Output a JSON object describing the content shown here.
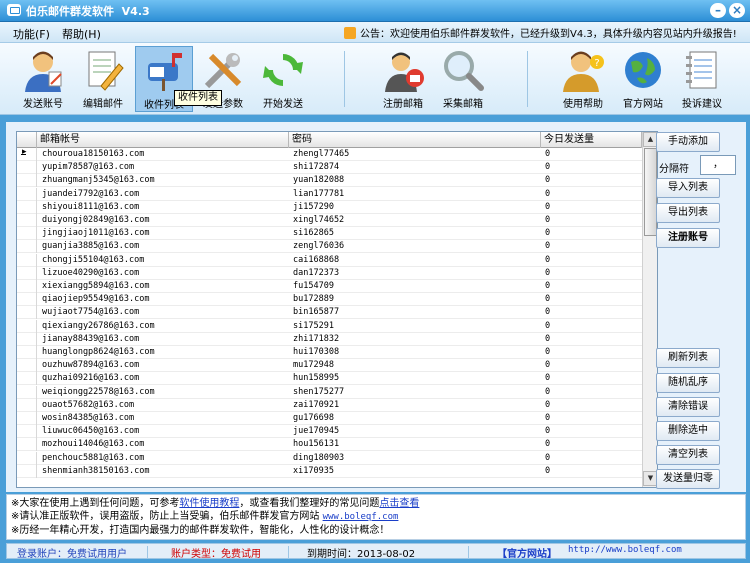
{
  "window": {
    "title": "伯乐邮件群发软件  V4.3"
  },
  "menu": {
    "items": [
      "功能(F)",
      "帮助(H)"
    ],
    "notice": "公告：欢迎使用伯乐邮件群发软件，已经升级到V4.3，具体升级内容见站内升级报告!"
  },
  "toolbar": {
    "items": [
      {
        "label": "发送账号",
        "icon": "user-account-icon"
      },
      {
        "label": "编辑邮件",
        "icon": "edit-document-icon"
      },
      {
        "label": "收件列表",
        "icon": "mailbox-icon",
        "selected": true
      },
      {
        "label": "发送参数",
        "icon": "tools-icon"
      },
      {
        "label": "开始发送",
        "icon": "refresh-send-icon"
      },
      {
        "label": "注册邮箱",
        "icon": "register-mail-icon"
      },
      {
        "label": "采集邮箱",
        "icon": "magnifier-icon"
      },
      {
        "label": "使用帮助",
        "icon": "help-user-icon"
      },
      {
        "label": "官方网站",
        "icon": "globe-icon"
      },
      {
        "label": "投诉建议",
        "icon": "notebook-icon"
      }
    ],
    "tooltip": "收件列表"
  },
  "grid": {
    "columns": [
      "邮箱帐号",
      "密码",
      "今日发送量"
    ],
    "rows": [
      [
        "chouroua18150163.com",
        "zhengl77465",
        "0"
      ],
      [
        "yupim78587@163.com",
        "shi172874",
        "0"
      ],
      [
        "zhuangmanj5345@163.com",
        "yuan182088",
        "0"
      ],
      [
        "juandei7792@163.com",
        "lian177781",
        "0"
      ],
      [
        "shiyoui8111@163.com",
        "ji157290",
        "0"
      ],
      [
        "duiyongj02849@163.com",
        "xingl74652",
        "0"
      ],
      [
        "jingjiaoj1011@163.com",
        "si162865",
        "0"
      ],
      [
        "guanjia3885@163.com",
        "zengl76036",
        "0"
      ],
      [
        "chongji55104@163.com",
        "cai168868",
        "0"
      ],
      [
        "lizuoe40290@163.com",
        "dan172373",
        "0"
      ],
      [
        "xiexiangg5894@163.com",
        "fu154709",
        "0"
      ],
      [
        "qiaojiep95549@163.com",
        "bu172889",
        "0"
      ],
      [
        "wujiaot7754@163.com",
        "bin165877",
        "0"
      ],
      [
        "qiexiangy26786@163.com",
        "si175291",
        "0"
      ],
      [
        "jianay88439@163.com",
        "zhi171832",
        "0"
      ],
      [
        "huanglongp8624@163.com",
        "hui170308",
        "0"
      ],
      [
        "ouzhuw87894@163.com",
        "mu172948",
        "0"
      ],
      [
        "quzhai09216@163.com",
        "hun158995",
        "0"
      ],
      [
        "weiqiongg22578@163.com",
        "shen175277",
        "0"
      ],
      [
        "ouaot57682@163.com",
        "zai170921",
        "0"
      ],
      [
        "wosin84385@163.com",
        "gu176698",
        "0"
      ],
      [
        "liuwuc06450@163.com",
        "jue170945",
        "0"
      ],
      [
        "mozhoui14046@163.com",
        "hou156131",
        "0"
      ],
      [
        "penchouc5881@163.com",
        "ding180903",
        "0"
      ],
      [
        "shenmianh38150163.com",
        "xi170935",
        "0"
      ]
    ]
  },
  "side": {
    "manual_add": "手动添加",
    "separator_label": "分隔符",
    "separator_value": "，",
    "import": "导入列表",
    "export": "导出列表",
    "register": "注册账号",
    "refresh": "刷新列表",
    "shuffle": "随机乱序",
    "clear_errors": "清除错误",
    "delete_selected": "删除选中",
    "clear_list": "清空列表",
    "reset_count": "发送量归零"
  },
  "notes": {
    "l1_a": "※大家在使用上遇到任何问题，可参考",
    "l1_link1": "软件使用教程",
    "l1_b": "，或查看我们整理好的常见问题",
    "l1_link2": "点击查看",
    "l2_a": "※请认准正版软件，误用盗版，防止上当受骗，伯乐邮件群发官方网站",
    "l2_url": "www.boleqf.com",
    "l3": "※历经一年精心开发，打造国内最强力的邮件群发软件，智能化，人性化的设计概念！"
  },
  "status": {
    "login": "登录账户：免费试用用户",
    "account_type": "账户类型：免费试用",
    "expiry": "到期时间：2013-08-02",
    "site_label": "【官方网站】",
    "site_url": "http://www.boleqf.com"
  },
  "colors": {
    "accent": "#2d8fd6",
    "warn": "#d00000",
    "link": "#1a3ec8"
  }
}
